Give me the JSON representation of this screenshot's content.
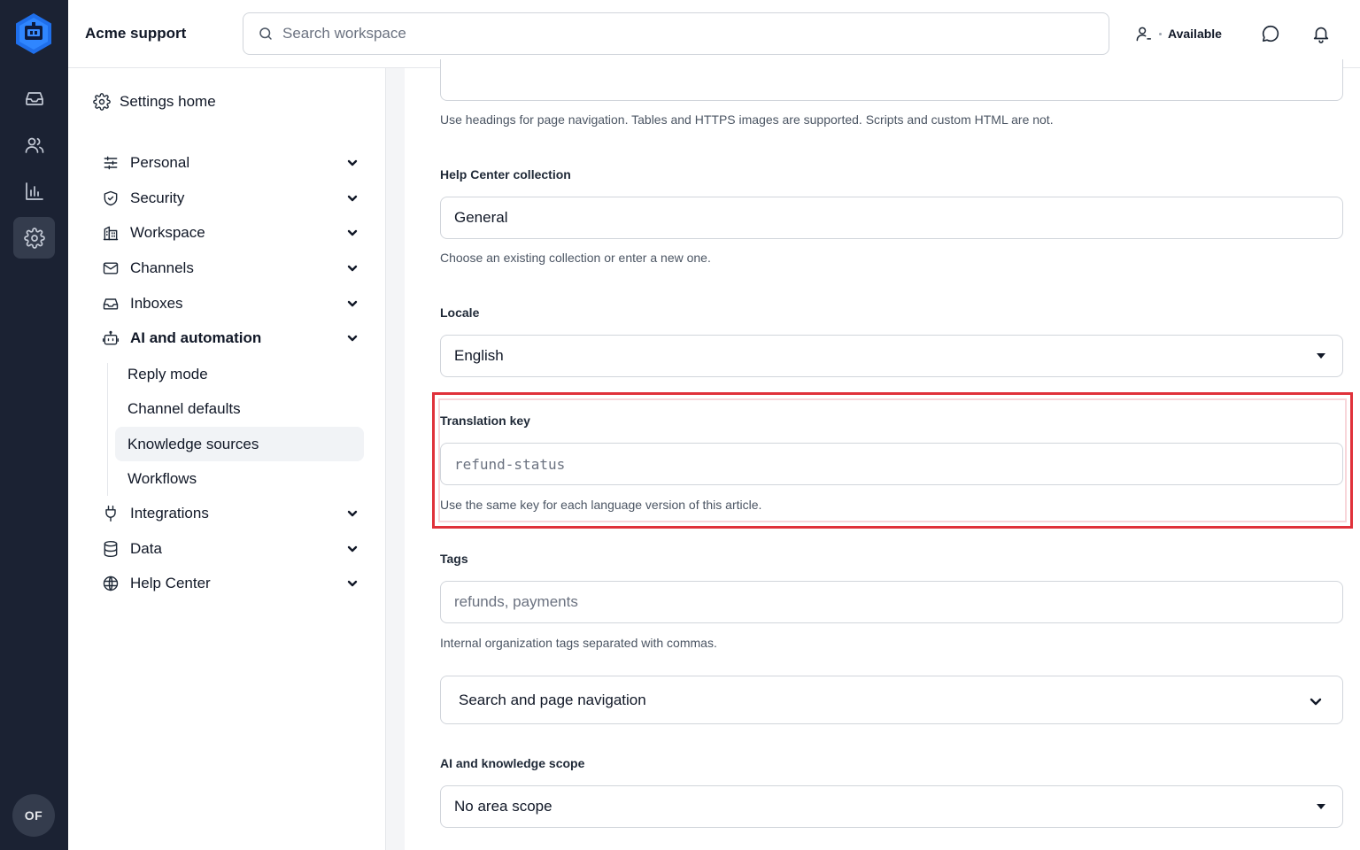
{
  "app": {
    "title": "Acme support"
  },
  "search": {
    "placeholder": "Search workspace"
  },
  "user_status": {
    "label": "Available"
  },
  "rail": {
    "items": [
      {
        "icon": "inbox-icon"
      },
      {
        "icon": "people-icon"
      },
      {
        "icon": "bar-chart-icon"
      },
      {
        "icon": "gear-icon",
        "active": true
      }
    ],
    "avatar_initials": "OF"
  },
  "settings_nav": {
    "home_label": "Settings home",
    "items": [
      {
        "label": "Personal",
        "icon": "sliders-icon"
      },
      {
        "label": "Security",
        "icon": "shield-icon"
      },
      {
        "label": "Workspace",
        "icon": "building-icon"
      },
      {
        "label": "Channels",
        "icon": "mail-icon"
      },
      {
        "label": "Inboxes",
        "icon": "inbox-icon"
      },
      {
        "label": "AI and automation",
        "icon": "bot-icon",
        "expanded": true
      },
      {
        "label": "Integrations",
        "icon": "plug-icon"
      },
      {
        "label": "Data",
        "icon": "database-icon"
      },
      {
        "label": "Help Center",
        "icon": "globe-icon"
      }
    ],
    "sub_items": [
      {
        "label": "Reply mode"
      },
      {
        "label": "Channel defaults"
      },
      {
        "label": "Knowledge sources",
        "active": true
      },
      {
        "label": "Workflows"
      }
    ]
  },
  "form": {
    "body_help": "Use headings for page navigation. Tables and HTTPS images are supported. Scripts and custom HTML are not.",
    "collection": {
      "label": "Help Center collection",
      "value": "General",
      "help": "Choose an existing collection or enter a new one."
    },
    "locale": {
      "label": "Locale",
      "value": "English"
    },
    "translation_key": {
      "label": "Translation key",
      "placeholder": "refund-status",
      "help": "Use the same key for each language version of this article."
    },
    "tags": {
      "label": "Tags",
      "placeholder": "refunds, payments",
      "help": "Internal organization tags separated with commas."
    },
    "accordion": {
      "label": "Search and page navigation"
    },
    "scope": {
      "label": "AI and knowledge scope",
      "value": "No area scope"
    }
  },
  "colors": {
    "rail_bg": "#1b2233",
    "highlight": "#e0313a",
    "logo_blue": "#1f6feb"
  }
}
